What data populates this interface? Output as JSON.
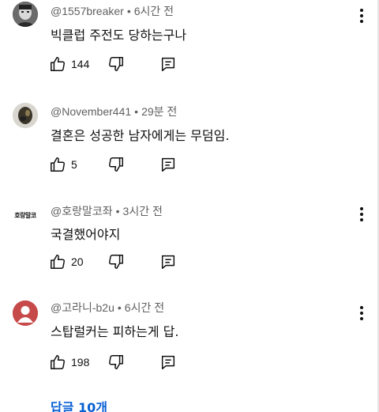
{
  "comments": [
    {
      "handle": "@1557breaker",
      "time": "6시간 전",
      "text": "빅클럽 주전도 당하는구나",
      "likes": "144",
      "avatar": "photo-face"
    },
    {
      "handle": "@November441",
      "time": "29분 전",
      "text": "결혼은 성공한 남자에게는 무덤임.",
      "likes": "5",
      "avatar": "photo-dark"
    },
    {
      "handle": "@호랑말코좌",
      "time": "3시간 전",
      "text": "국결했어야지",
      "likes": "20",
      "avatar": "text-logo",
      "avatar_text": "호랑말코"
    },
    {
      "handle": "@고라니-b2u",
      "time": "6시간 전",
      "text": "스탑럴커는 피하는게 답.",
      "likes": "198",
      "avatar": "default-person"
    }
  ],
  "replies_label": "답글 10개",
  "colors": {
    "link": "#065fd4",
    "meta": "#606060",
    "default_avatar": "#c74a4a"
  }
}
